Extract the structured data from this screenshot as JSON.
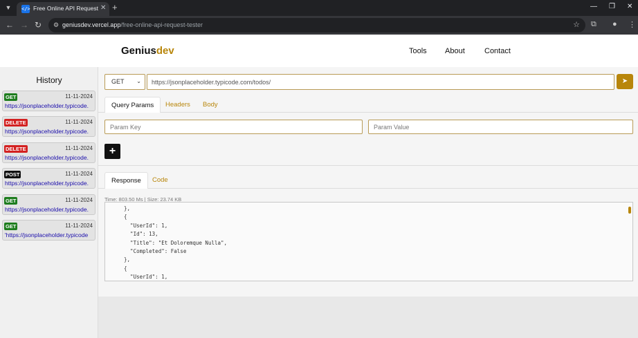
{
  "browser": {
    "tab_title": "Free Online API Request Tester",
    "tab_favicon": "</>",
    "tab_close": "✕",
    "new_tab": "+",
    "url_host": "geniusdev.vercel.app",
    "url_path": "/free-online-api-request-tester"
  },
  "site": {
    "logo_main": "Genius",
    "logo_accent": "dev",
    "nav": [
      "Tools",
      "About",
      "Contact"
    ]
  },
  "sidebar": {
    "title": "History",
    "items": [
      {
        "method": "GET",
        "date": "11-11-2024",
        "url": "https://jsonplaceholder.typicode.",
        "color": "#1e7d1e"
      },
      {
        "method": "DELETE",
        "date": "11-11-2024",
        "url": "https://jsonplaceholder.typicode.",
        "color": "#d32020"
      },
      {
        "method": "DELETE",
        "date": "11-11-2024",
        "url": "https://jsonplaceholder.typicode.",
        "color": "#d32020"
      },
      {
        "method": "POST",
        "date": "11-11-2024",
        "url": "https://jsonplaceholder.typicode.",
        "color": "#111111"
      },
      {
        "method": "GET",
        "date": "11-11-2024",
        "url": "https://jsonplaceholder.typicode.",
        "color": "#1e7d1e"
      },
      {
        "method": "GET",
        "date": "11-11-2024",
        "url": "'https://jsonplaceholder.typicode",
        "color": "#1e7d1e"
      }
    ]
  },
  "request": {
    "method": "GET",
    "url": "https://jsonplaceholder.typicode.com/todos/",
    "send_icon": "send-icon",
    "tabs": [
      "Query Params",
      "Headers",
      "Body"
    ],
    "param_key_placeholder": "Param Key",
    "param_value_placeholder": "Param Value",
    "add_label": "+"
  },
  "response": {
    "tabs": [
      "Response",
      "Code"
    ],
    "meta": "Time: 803.50 Ms | Size: 23.74 KB",
    "body": "  },\n  {\n    \"UserId\": 1,\n    \"Id\": 13,\n    \"Title\": \"Et Doloremque Nulla\",\n    \"Completed\": False\n  },\n  {\n    \"UserId\": 1,"
  },
  "colors": {
    "accent": "#b8860b",
    "link": "#1a0dab"
  }
}
